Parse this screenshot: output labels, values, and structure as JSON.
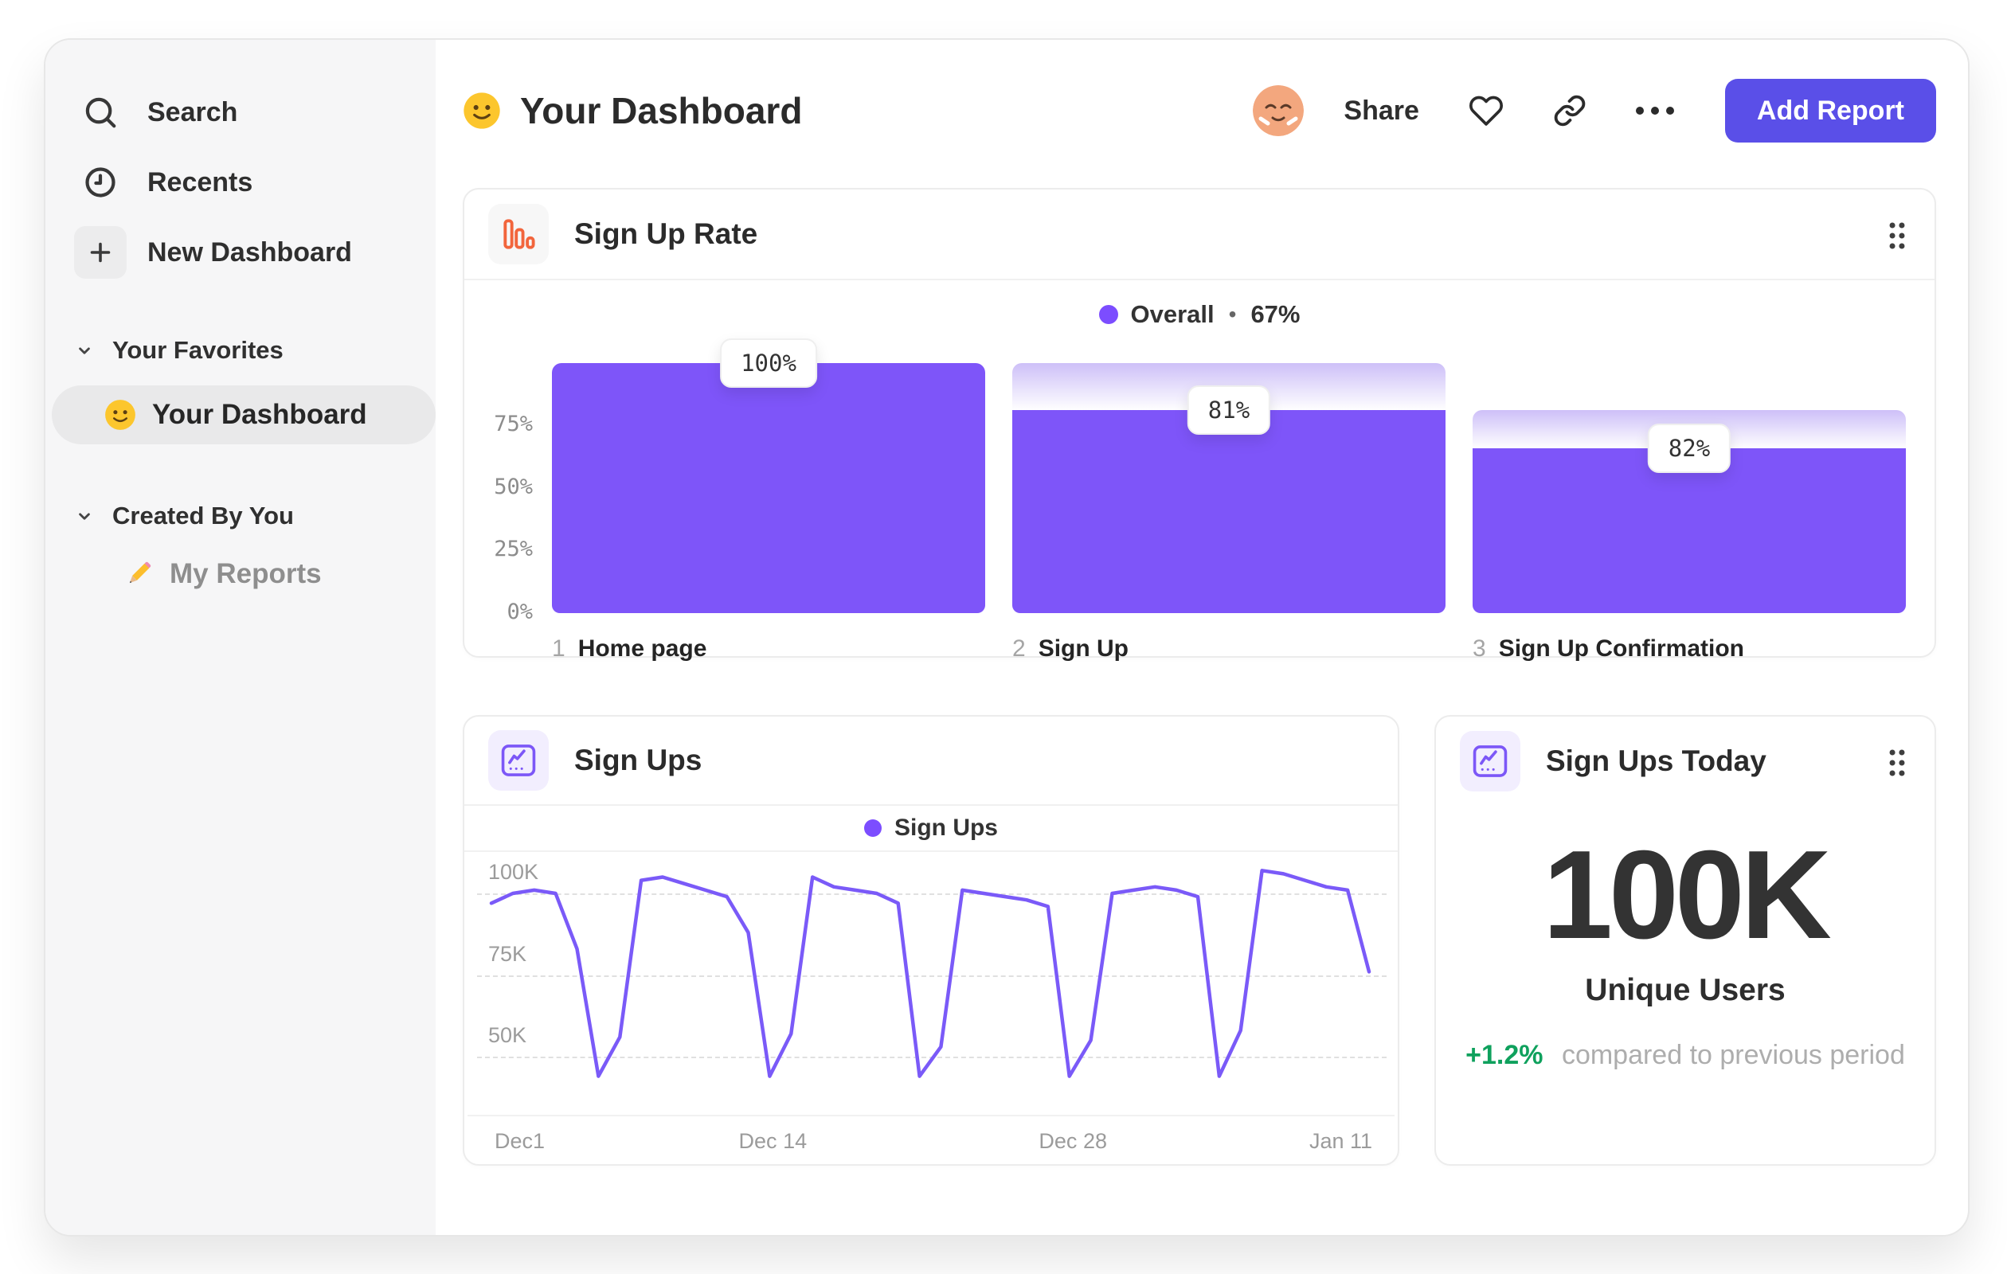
{
  "header": {
    "emoji": "slightly-smiling-face",
    "title": "Your Dashboard",
    "avatar": "relieved-face",
    "actions": {
      "share": "Share",
      "add_report": "Add Report"
    }
  },
  "sidebar": {
    "nav": [
      {
        "icon": "search-icon",
        "label": "Search"
      },
      {
        "icon": "clock-icon",
        "label": "Recents"
      },
      {
        "icon": "plus-icon",
        "label": "New Dashboard"
      }
    ],
    "sections": [
      {
        "title": "Your Favorites",
        "items": [
          {
            "emoji": "slightly-smiling-face",
            "label": "Your Dashboard",
            "selected": true
          }
        ]
      },
      {
        "title": "Created By You",
        "items": [
          {
            "emoji": "pencil",
            "label": "My Reports",
            "selected": false
          }
        ]
      }
    ]
  },
  "colors": {
    "accent_purple": "#7E55F9",
    "legend_dot_purple": "#7C4DFF",
    "button_indigo": "#5A4FE8",
    "positive_green": "#0FA15D",
    "card_border": "#ECECEC",
    "sidebar_bg": "#F6F6F7",
    "funnel_icon_orange": "#F2653C"
  },
  "chart_data": [
    {
      "type": "bar",
      "variant": "funnel",
      "title": "Sign Up Rate",
      "legend": {
        "label": "Overall",
        "separator": "•",
        "value": "67%"
      },
      "overall_conversion_pct": 67,
      "categories": [
        "Home page",
        "Sign Up",
        "Sign Up Confirmation"
      ],
      "step_numbers": [
        "1",
        "2",
        "3"
      ],
      "step_values_pct": [
        100,
        81,
        82
      ],
      "value_labels": [
        "100%",
        "81%",
        "82%"
      ],
      "cumulative_pct": [
        100,
        81,
        66
      ],
      "ghost_from_pct": [
        null,
        100,
        81
      ],
      "ytick_labels": [
        "75%",
        "50%",
        "25%",
        "0%"
      ],
      "ytick_values": [
        75,
        50,
        25,
        0
      ],
      "ylim": [
        0,
        105
      ],
      "bar_color": "#7E55F9"
    },
    {
      "type": "line",
      "title": "Sign Ups",
      "legend": {
        "label": "Sign Ups"
      },
      "x_tick_labels": [
        "Dec1",
        "Dec 14",
        "Dec 28",
        "Jan 11"
      ],
      "x_tick_fractions": [
        0,
        0.317,
        0.659,
        1.0
      ],
      "ytick_labels": [
        "100K",
        "75K",
        "50K"
      ],
      "ytick_values": [
        100,
        75,
        50
      ],
      "ylim": [
        38,
        112
      ],
      "unit": "thousands",
      "values": [
        97,
        100,
        101,
        100,
        83,
        44,
        56,
        104,
        105,
        103,
        101,
        99,
        88,
        44,
        57,
        105,
        102,
        101,
        100,
        97,
        44,
        53,
        101,
        100,
        99,
        98,
        96,
        44,
        55,
        100,
        101,
        102,
        101,
        99,
        44,
        58,
        107,
        106,
        104,
        102,
        101,
        76
      ],
      "line_color": "#7A5AF8",
      "grid": "dashed-horizontal"
    },
    {
      "type": "big_number",
      "title": "Sign Ups Today",
      "value": "100K",
      "label": "Unique Users",
      "delta": "+1.2%",
      "delta_direction": "up",
      "delta_color": "#0FA15D",
      "comparison": "compared to previous period"
    }
  ]
}
